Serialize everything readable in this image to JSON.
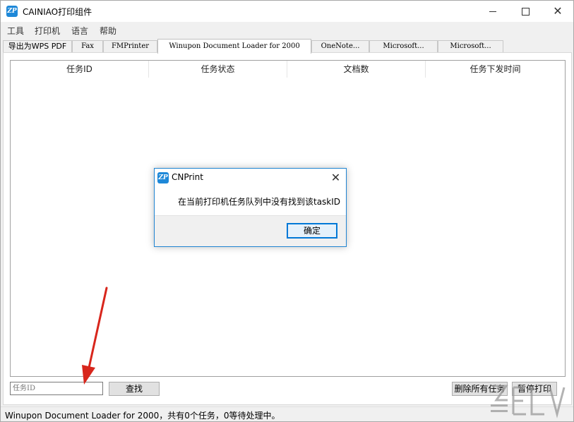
{
  "window": {
    "title": "CAINIAO打印组件",
    "icon": "cainiao-print-icon",
    "icon_text": "ZP"
  },
  "menu": {
    "items": [
      {
        "label": "工具"
      },
      {
        "label": "打印机"
      },
      {
        "label": "语言"
      },
      {
        "label": "帮助"
      }
    ]
  },
  "tabs": [
    {
      "label": "导出为WPS PDF",
      "active": false
    },
    {
      "label": "Fax",
      "active": false
    },
    {
      "label": "FMPrinter",
      "active": false
    },
    {
      "label": "Winupon Document Loader for 2000",
      "active": true
    },
    {
      "label": "OneNote...",
      "active": false
    },
    {
      "label": "Microsoft...",
      "active": false
    },
    {
      "label": "Microsoft...",
      "active": false
    }
  ],
  "table": {
    "columns": [
      "任务ID",
      "任务状态",
      "文档数",
      "任务下发时间"
    ],
    "rows": []
  },
  "controls": {
    "taskid_placeholder": "任务ID",
    "find_label": "查找",
    "delete_all_label": "删除所有任务",
    "pause_label": "暂停打印"
  },
  "status": {
    "text": "Winupon Document Loader for 2000，共有0个任务，0等待处理中。"
  },
  "dialog": {
    "title": "CNPrint",
    "icon_text": "ZP",
    "message": "在当前打印机任务队列中没有找到该taskID",
    "ok_label": "确定"
  },
  "colors": {
    "accent": "#1e88d8",
    "dialog_border": "#1f84d2",
    "arrow": "#d8261c"
  }
}
